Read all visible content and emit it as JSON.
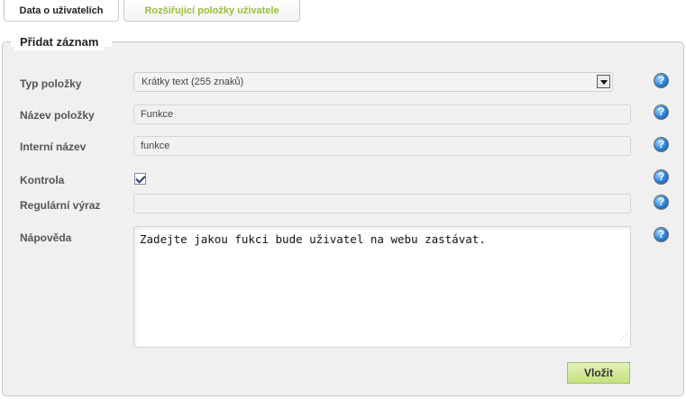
{
  "tabs": [
    {
      "label": "Data o uživatelích",
      "active": true
    },
    {
      "label": "Rozšiřující položky uživatele",
      "active": false
    }
  ],
  "form": {
    "legend": "Přidat záznam",
    "type": {
      "label": "Typ položky",
      "value": "Krátky text (255 znaků)"
    },
    "name": {
      "label": "Název položky",
      "value": "Funkce"
    },
    "internal": {
      "label": "Interní název",
      "value": "funkce"
    },
    "check": {
      "label": "Kontrola",
      "checked": true
    },
    "regex": {
      "label": "Regulární výraz",
      "value": ""
    },
    "help": {
      "label": "Nápověda",
      "value": "Zadejte jakou fukci bude uživatel na webu zastávat."
    },
    "submit_label": "Vložit"
  },
  "icons": {
    "help": "help-icon",
    "dropdown": "chevron-down-icon",
    "check": "checkmark-icon",
    "resize": "resize-grip-icon"
  },
  "colors": {
    "accent_green": "#9bbf3c",
    "button_green": "#c7e07b",
    "help_blue": "#2a7fd6"
  },
  "help_glyph": "?"
}
